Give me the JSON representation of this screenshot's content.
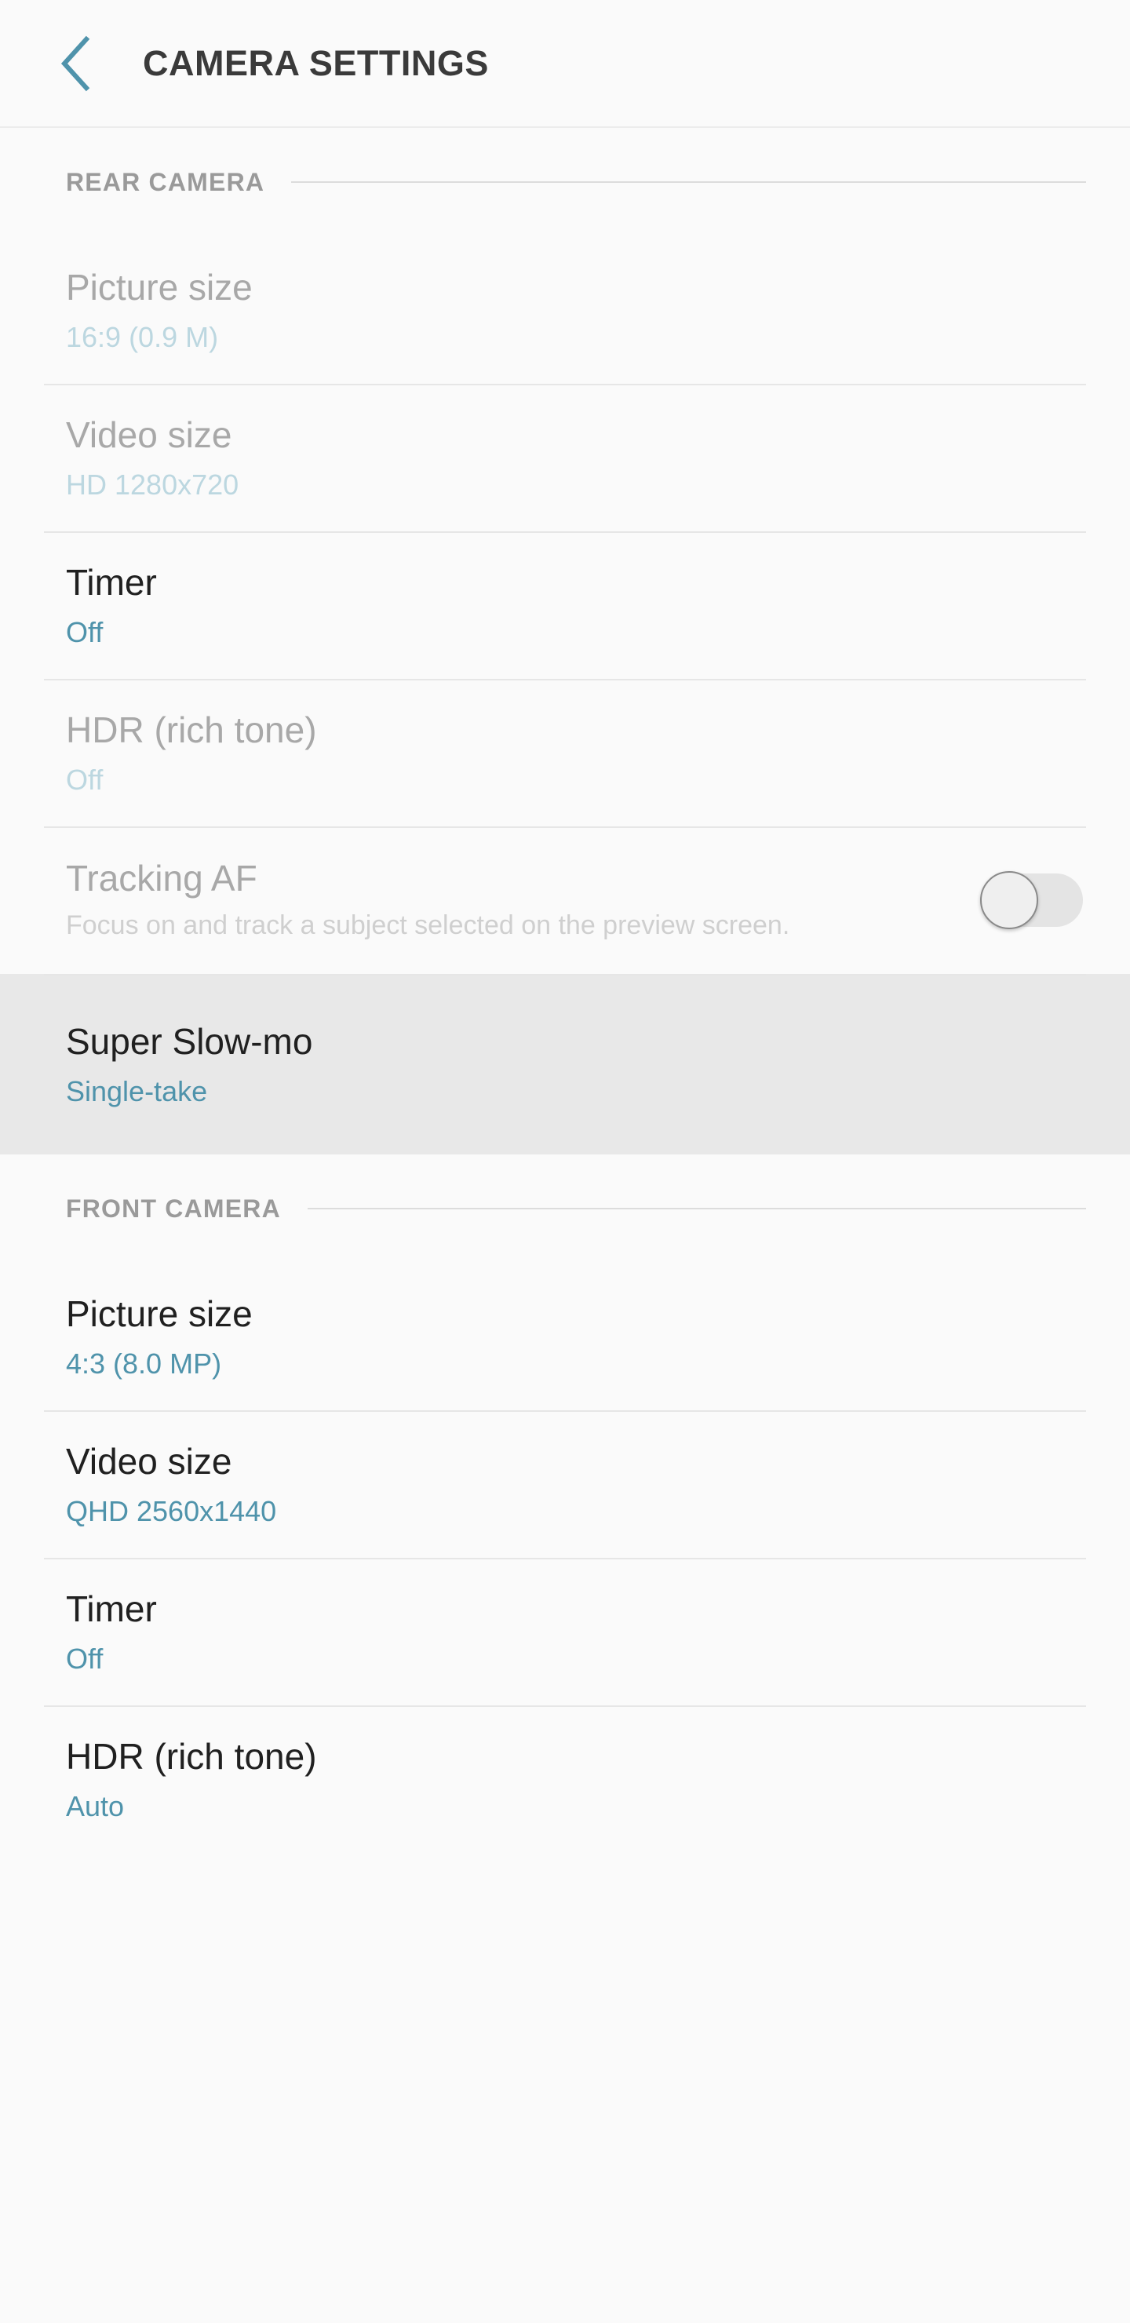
{
  "appbar": {
    "back_icon": "chevron-left-icon",
    "title": "CAMERA SETTINGS",
    "accent_color": "#4f93ab",
    "title_color": "#3a3a3a"
  },
  "colors": {
    "background": "#fafafa",
    "accent": "#4f93ab",
    "accent_dim": "#bcd7e0",
    "title": "#202020",
    "title_dim": "#a8a8a8",
    "section_label": "#9a9a9a",
    "divider": "#e6e6e6",
    "highlight_background": "#e8e8e8"
  },
  "sections": [
    {
      "label": "REAR CAMERA",
      "items": [
        {
          "title": "Picture size",
          "value": "16:9 (0.9 M)",
          "dimmed": true,
          "first": true,
          "type": "value"
        },
        {
          "title": "Video size",
          "value": "HD 1280x720",
          "dimmed": true,
          "type": "value"
        },
        {
          "title": "Timer",
          "value": "Off",
          "dimmed": false,
          "type": "value"
        },
        {
          "title": "HDR (rich tone)",
          "value": "Off",
          "dimmed": true,
          "type": "value"
        },
        {
          "title": "Tracking AF",
          "description": "Focus on and track a subject selected on the preview screen.",
          "dimmed": true,
          "type": "toggle",
          "toggle_state": "off"
        },
        {
          "title": "Super Slow-mo",
          "value": "Single-take",
          "dimmed": false,
          "highlighted": true,
          "type": "value"
        }
      ]
    },
    {
      "label": "FRONT CAMERA",
      "items": [
        {
          "title": "Picture size",
          "value": "4:3 (8.0 MP)",
          "dimmed": false,
          "first": true,
          "type": "value"
        },
        {
          "title": "Video size",
          "value": "QHD 2560x1440",
          "dimmed": false,
          "type": "value"
        },
        {
          "title": "Timer",
          "value": "Off",
          "dimmed": false,
          "type": "value"
        },
        {
          "title": "HDR (rich tone)",
          "value": "Auto",
          "dimmed": false,
          "type": "value"
        }
      ]
    }
  ]
}
